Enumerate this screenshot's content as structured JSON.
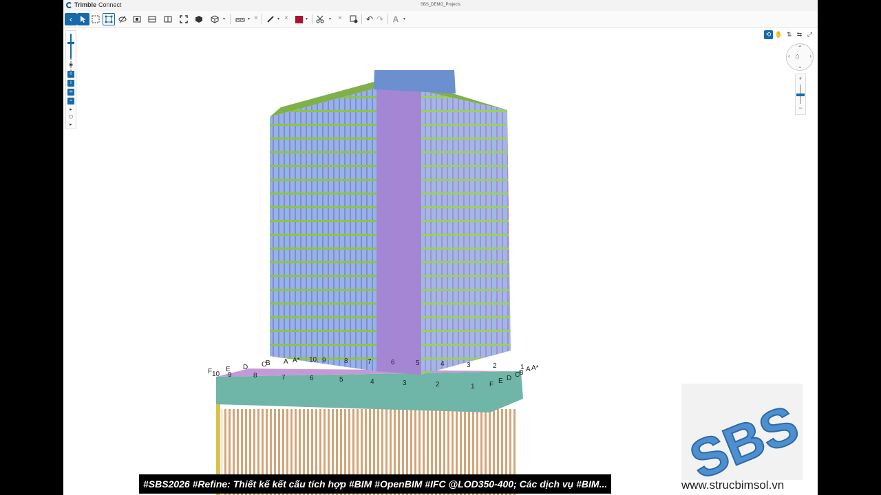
{
  "app": {
    "brand_bold": "Trimble",
    "brand_rest": "Connect",
    "project_title": "SBS_DEMO_Projects"
  },
  "toolbar": {
    "tools": [
      "back-icon",
      "select-icon",
      "area-select-icon",
      "smart-select-icon",
      "hide-icon",
      "section-box-icon",
      "section-plane-icon",
      "section-plane-2-icon",
      "fit-icon",
      "object-icon",
      "iso-view-icon",
      "measure-icon",
      "markup-pen-icon",
      "color-icon",
      "clip-icon",
      "view-settings-icon",
      "undo-icon",
      "redo-icon",
      "text-icon"
    ],
    "markup_color": "#b0102f",
    "accent": "#1769aa"
  },
  "model": {
    "grid_labels_top": [
      "F",
      "10",
      "E",
      "9",
      "D",
      "C",
      "B",
      "A",
      "A*",
      "10",
      "9",
      "8",
      "7",
      "6",
      "5",
      "4",
      "3",
      "2",
      "1",
      "A",
      "A*"
    ],
    "grid_labels_bottom": [
      "8",
      "7",
      "6",
      "5",
      "4",
      "3",
      "2",
      "1",
      "F",
      "E",
      "D",
      "C",
      "B"
    ]
  },
  "watermark": {
    "logo_text": "SBS",
    "website": "www.strucbimsol.vn"
  },
  "caption": "#SBS2026 #Refine: Thiết kế kết cấu tích hợp #BIM #OpenBIM #IFC @LOD350-400; Các dịch vụ #BIM..."
}
